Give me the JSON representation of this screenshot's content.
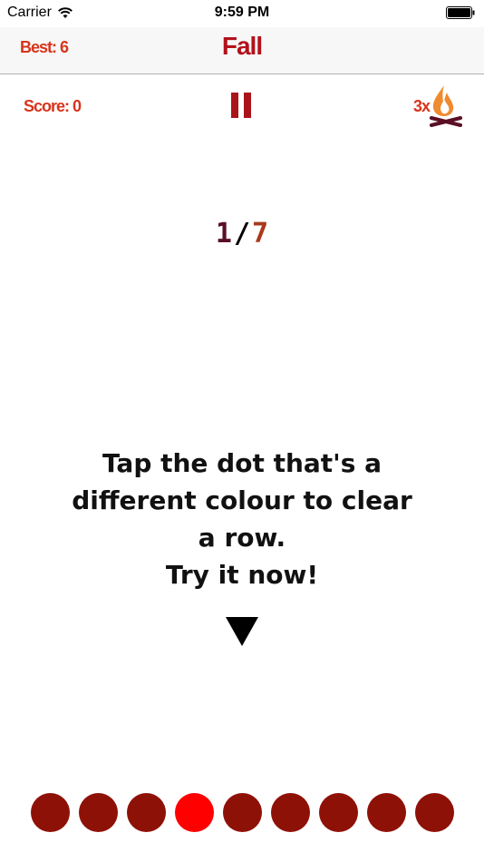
{
  "status_bar": {
    "carrier": "Carrier",
    "time": "9:59 PM"
  },
  "navbar": {
    "best": "Best: 6",
    "title": "Fall"
  },
  "game_bar": {
    "score": "Score: 0",
    "multiplier": "3x",
    "icon": "campfire-icon"
  },
  "progress": {
    "current": "1",
    "separator": "/",
    "total": "7"
  },
  "instructions": {
    "lines": [
      "Tap the dot that's a",
      "different colour to clear",
      "a row.",
      "Try it now!"
    ]
  },
  "row": {
    "dot_count": 9,
    "odd_index": 3,
    "normal_color": "#8e1108",
    "odd_color": "#ff0000"
  },
  "colors": {
    "accent": "#d9341b",
    "title": "#b3121b",
    "pause": "#a8141a"
  }
}
